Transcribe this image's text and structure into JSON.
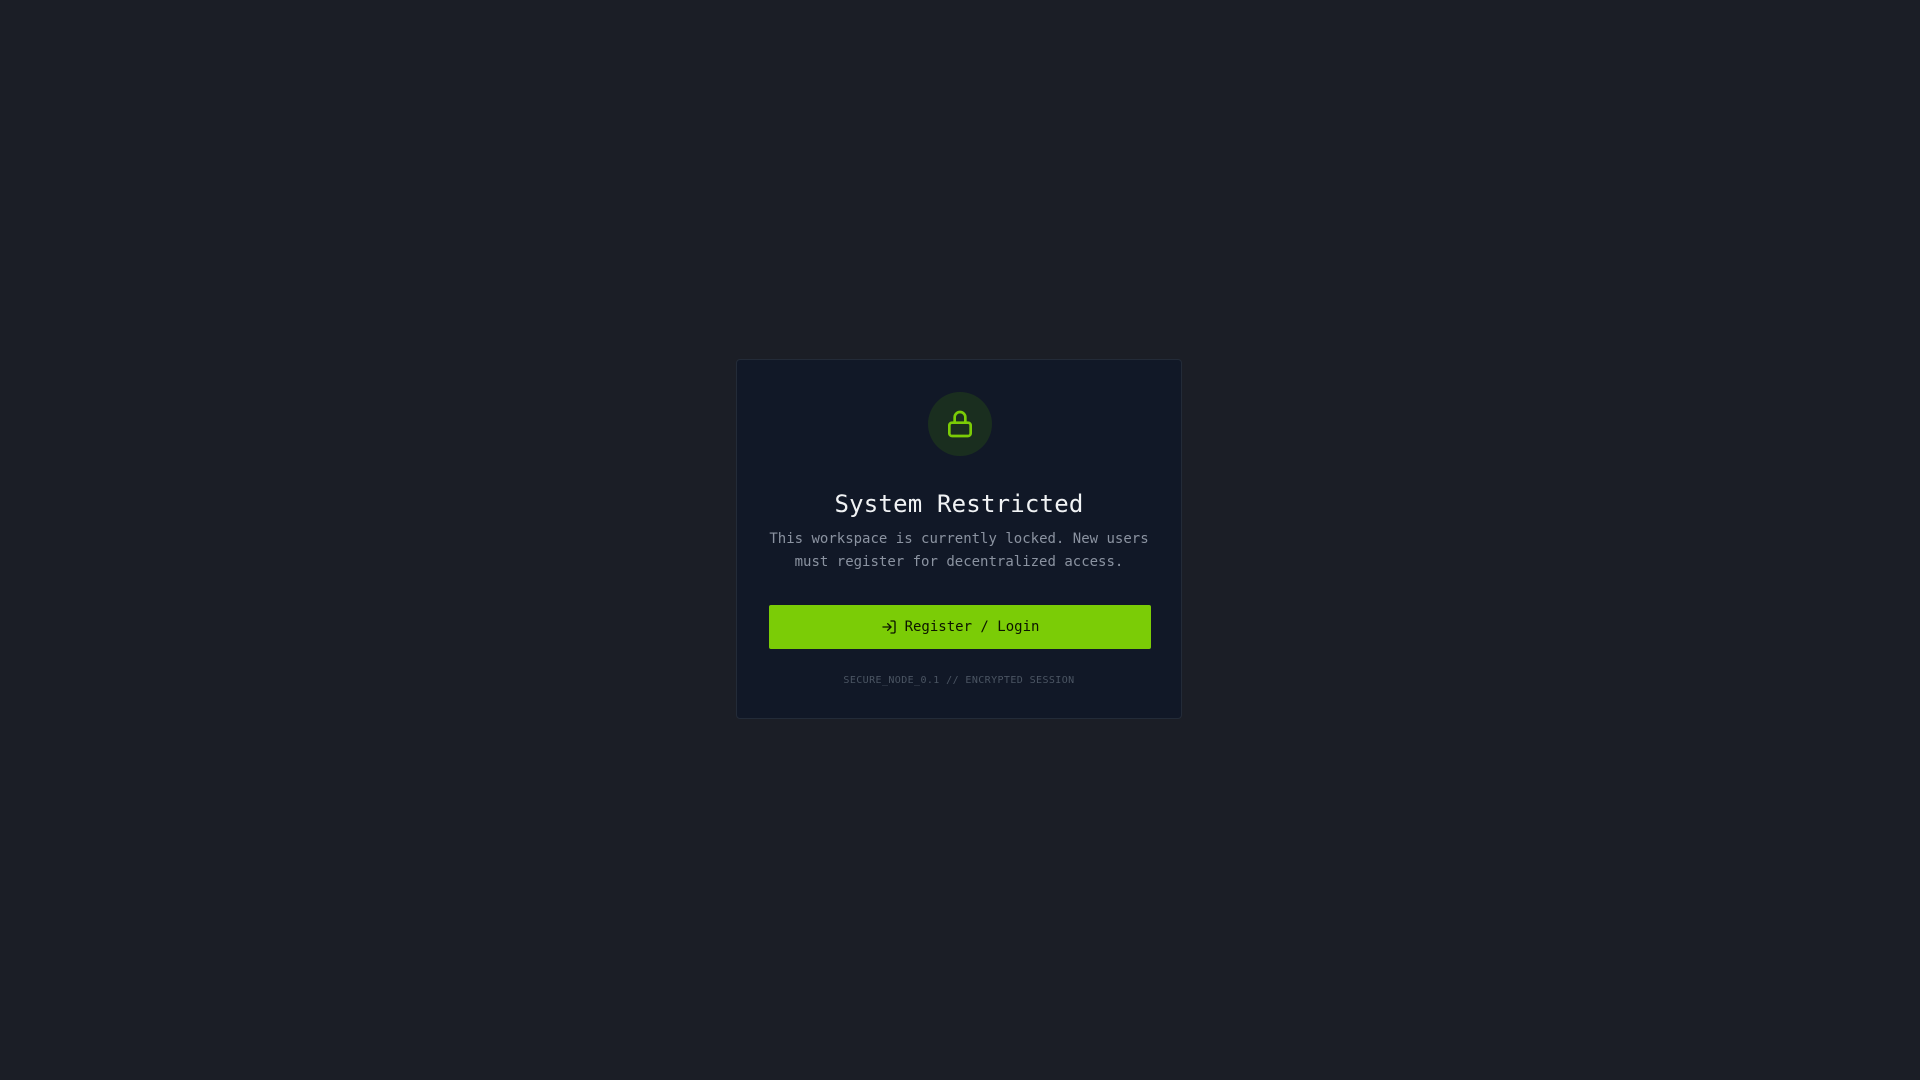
{
  "colors": {
    "background": "#1b1e26",
    "card": "#111827",
    "accent": "#7bcc06",
    "lock_badge": "#1a2e1f",
    "title": "#f1f3f5",
    "description": "#8b93a1",
    "footer": "#4b5563"
  },
  "icons": {
    "lock": "lock-icon",
    "login": "log-in-icon"
  },
  "card": {
    "title": "System Restricted",
    "description_line1": "This workspace is currently locked. New users",
    "description_line2": "must register for decentralized access.",
    "button_label": "Register / Login",
    "footer": "SECURE_NODE_0.1 // ENCRYPTED SESSION"
  }
}
